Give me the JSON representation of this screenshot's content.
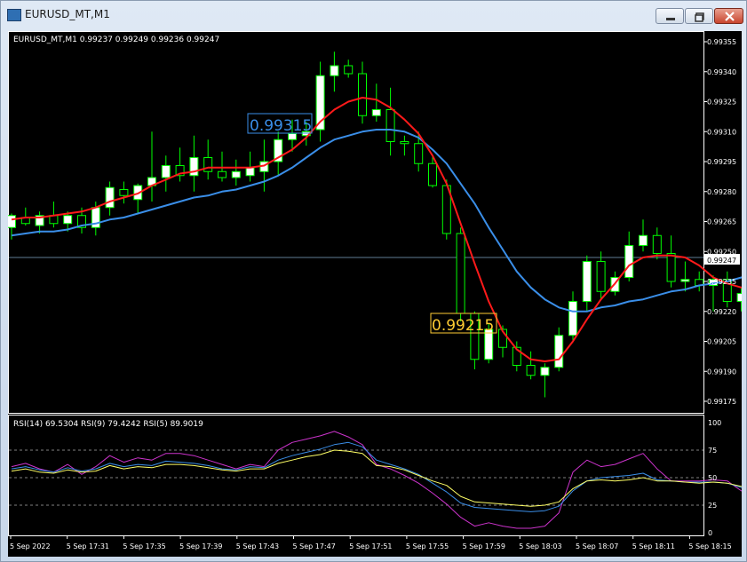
{
  "window": {
    "title": "EURUSD_MT,M1"
  },
  "main_chart": {
    "info": "EURUSD_MT,M1  0.99237 0.99249 0.99236 0.99247",
    "current_price_label": "0.99247",
    "price_levels": [
      "0.99355",
      "0.99340",
      "0.99325",
      "0.99310",
      "0.99295",
      "0.99280",
      "0.99265",
      "0.99250",
      "0.99235",
      "0.99220",
      "0.99205",
      "0.99190",
      "0.99175"
    ],
    "annotations": [
      {
        "text": "0.99315",
        "color": "#3a8ee8"
      },
      {
        "text": "0.99215",
        "color": "#ffcc33"
      }
    ]
  },
  "rsi_panel": {
    "info": "RSI(14) 69.5304  RSI(9) 79.4242  RSI(5) 89.9019",
    "levels": [
      "100",
      "75",
      "50",
      "25",
      "0"
    ]
  },
  "time_labels": [
    "5 Sep 2022",
    "5 Sep 17:31",
    "5 Sep 17:35",
    "5 Sep 17:39",
    "5 Sep 17:43",
    "5 Sep 17:47",
    "5 Sep 17:51",
    "5 Sep 17:55",
    "5 Sep 17:59",
    "5 Sep 18:03",
    "5 Sep 18:07",
    "5 Sep 18:11",
    "5 Sep 18:15"
  ],
  "colors": {
    "bull_body": "#ffffff",
    "bear_body": "#000000",
    "candle_outline": "#00ff00",
    "ma_fast": "#ff1a1a",
    "ma_slow": "#3a8ee8",
    "rsi14": "#3a8ee8",
    "rsi9": "#ffff66",
    "rsi5": "#cc33cc"
  },
  "chart_data": {
    "type": "candlestick",
    "ohlc": [
      [
        0.99262,
        0.99269,
        0.99256,
        0.99268
      ],
      [
        0.99267,
        0.99272,
        0.99263,
        0.99264
      ],
      [
        0.99263,
        0.9927,
        0.99259,
        0.99268
      ],
      [
        0.99268,
        0.99275,
        0.99262,
        0.99264
      ],
      [
        0.99264,
        0.9927,
        0.9926,
        0.99268
      ],
      [
        0.99268,
        0.99272,
        0.99259,
        0.99262
      ],
      [
        0.99262,
        0.99275,
        0.99258,
        0.99272
      ],
      [
        0.99272,
        0.99285,
        0.99268,
        0.99282
      ],
      [
        0.99281,
        0.99285,
        0.99274,
        0.99278
      ],
      [
        0.99276,
        0.99284,
        0.99269,
        0.99283
      ],
      [
        0.99283,
        0.9931,
        0.99275,
        0.99287
      ],
      [
        0.99287,
        0.99298,
        0.9928,
        0.99293
      ],
      [
        0.99293,
        0.99302,
        0.99285,
        0.99288
      ],
      [
        0.99288,
        0.99308,
        0.9928,
        0.99297
      ],
      [
        0.99297,
        0.99306,
        0.99286,
        0.9929
      ],
      [
        0.9929,
        0.993,
        0.99285,
        0.99287
      ],
      [
        0.99287,
        0.99296,
        0.99283,
        0.9929
      ],
      [
        0.99288,
        0.993,
        0.99285,
        0.99292
      ],
      [
        0.9929,
        0.99306,
        0.9928,
        0.99295
      ],
      [
        0.99295,
        0.9931,
        0.99288,
        0.99306
      ],
      [
        0.99306,
        0.99316,
        0.993,
        0.99309
      ],
      [
        0.99308,
        0.99315,
        0.99303,
        0.9931
      ],
      [
        0.99311,
        0.99345,
        0.99305,
        0.99338
      ],
      [
        0.99338,
        0.9935,
        0.9933,
        0.99343
      ],
      [
        0.99343,
        0.99346,
        0.99337,
        0.99339
      ],
      [
        0.99339,
        0.99345,
        0.99314,
        0.99318
      ],
      [
        0.99318,
        0.99334,
        0.99315,
        0.99321
      ],
      [
        0.99321,
        0.99332,
        0.99298,
        0.99305
      ],
      [
        0.99305,
        0.99308,
        0.99298,
        0.99304
      ],
      [
        0.99304,
        0.9931,
        0.9929,
        0.99294
      ],
      [
        0.99294,
        0.99298,
        0.99282,
        0.99283
      ],
      [
        0.99283,
        0.99286,
        0.99256,
        0.99259
      ],
      [
        0.99259,
        0.99262,
        0.99215,
        0.99219
      ],
      [
        0.99219,
        0.9922,
        0.99191,
        0.99196
      ],
      [
        0.99196,
        0.99214,
        0.99194,
        0.99211
      ],
      [
        0.99211,
        0.99213,
        0.99197,
        0.99202
      ],
      [
        0.99202,
        0.99205,
        0.9919,
        0.99193
      ],
      [
        0.99193,
        0.992,
        0.99186,
        0.99188
      ],
      [
        0.99188,
        0.99194,
        0.99177,
        0.99192
      ],
      [
        0.99192,
        0.99212,
        0.9919,
        0.99208
      ],
      [
        0.99208,
        0.9923,
        0.99205,
        0.99225
      ],
      [
        0.99225,
        0.99248,
        0.9922,
        0.99245
      ],
      [
        0.99245,
        0.9925,
        0.99226,
        0.9923
      ],
      [
        0.9923,
        0.9924,
        0.99228,
        0.99237
      ],
      [
        0.99237,
        0.9926,
        0.99235,
        0.99253
      ],
      [
        0.99253,
        0.99266,
        0.9925,
        0.99258
      ],
      [
        0.99258,
        0.99262,
        0.99246,
        0.99249
      ],
      [
        0.99249,
        0.99258,
        0.99232,
        0.99235
      ],
      [
        0.99235,
        0.99245,
        0.9923,
        0.99236
      ],
      [
        0.99236,
        0.9924,
        0.9923,
        0.99233
      ],
      [
        0.99233,
        0.99238,
        0.9922,
        0.99236
      ],
      [
        0.99236,
        0.9924,
        0.99222,
        0.99225
      ],
      [
        0.99225,
        0.99232,
        0.9922,
        0.99229
      ],
      [
        0.99229,
        0.99232,
        0.99223,
        0.99226
      ]
    ],
    "ma_fast": [
      0.99266,
      0.99267,
      0.99267,
      0.99268,
      0.99269,
      0.9927,
      0.99272,
      0.99275,
      0.99277,
      0.99279,
      0.99283,
      0.99286,
      0.99289,
      0.9929,
      0.99292,
      0.99292,
      0.99292,
      0.99292,
      0.99293,
      0.99297,
      0.99301,
      0.99307,
      0.99315,
      0.99321,
      0.99325,
      0.99327,
      0.99326,
      0.99322,
      0.99316,
      0.99309,
      0.99298,
      0.99284,
      0.99264,
      0.99244,
      0.99225,
      0.9921,
      0.99201,
      0.99196,
      0.99195,
      0.99196,
      0.99205,
      0.99216,
      0.99226,
      0.99234,
      0.99243,
      0.99247,
      0.99248,
      0.99248,
      0.99247,
      0.99243,
      0.99237,
      0.99234,
      0.99232,
      0.9923
    ],
    "ma_slow": [
      0.99258,
      0.99259,
      0.9926,
      0.9926,
      0.99261,
      0.99263,
      0.99264,
      0.99266,
      0.99267,
      0.99269,
      0.99271,
      0.99273,
      0.99275,
      0.99277,
      0.99278,
      0.9928,
      0.99281,
      0.99283,
      0.99285,
      0.99288,
      0.99292,
      0.99297,
      0.99302,
      0.99306,
      0.99308,
      0.9931,
      0.99311,
      0.99311,
      0.9931,
      0.99307,
      0.99301,
      0.99294,
      0.99284,
      0.99274,
      0.99262,
      0.99251,
      0.9924,
      0.99232,
      0.99226,
      0.99222,
      0.9922,
      0.9922,
      0.99222,
      0.99223,
      0.99225,
      0.99226,
      0.99228,
      0.9923,
      0.99231,
      0.99233,
      0.99234,
      0.99235,
      0.99237,
      0.99238
    ],
    "rsi14": [
      58,
      60,
      57,
      55,
      59,
      56,
      58,
      63,
      60,
      62,
      61,
      65,
      64,
      63,
      61,
      58,
      57,
      60,
      59,
      66,
      70,
      73,
      76,
      80,
      82,
      78,
      66,
      62,
      58,
      53,
      45,
      37,
      27,
      23,
      22,
      21,
      20,
      19,
      20,
      24,
      38,
      47,
      50,
      51,
      52,
      54,
      48,
      47,
      46,
      46,
      46,
      45,
      41,
      40
    ],
    "rsi9": [
      56,
      58,
      55,
      54,
      57,
      55,
      56,
      61,
      58,
      60,
      59,
      62,
      62,
      61,
      59,
      57,
      56,
      58,
      58,
      63,
      66,
      69,
      71,
      75,
      74,
      72,
      61,
      60,
      57,
      52,
      47,
      43,
      33,
      28,
      27,
      26,
      25,
      24,
      25,
      28,
      40,
      47,
      48,
      47,
      48,
      50,
      47,
      47,
      46,
      45,
      46,
      45,
      42,
      42
    ],
    "rsi5": [
      60,
      63,
      58,
      55,
      62,
      53,
      60,
      70,
      64,
      68,
      66,
      72,
      72,
      70,
      66,
      62,
      58,
      62,
      60,
      75,
      82,
      85,
      88,
      92,
      87,
      80,
      62,
      58,
      52,
      45,
      36,
      26,
      14,
      6,
      9,
      6,
      4,
      4,
      6,
      18,
      55,
      66,
      60,
      62,
      67,
      72,
      58,
      47,
      47,
      47,
      48,
      47,
      38,
      37
    ]
  }
}
